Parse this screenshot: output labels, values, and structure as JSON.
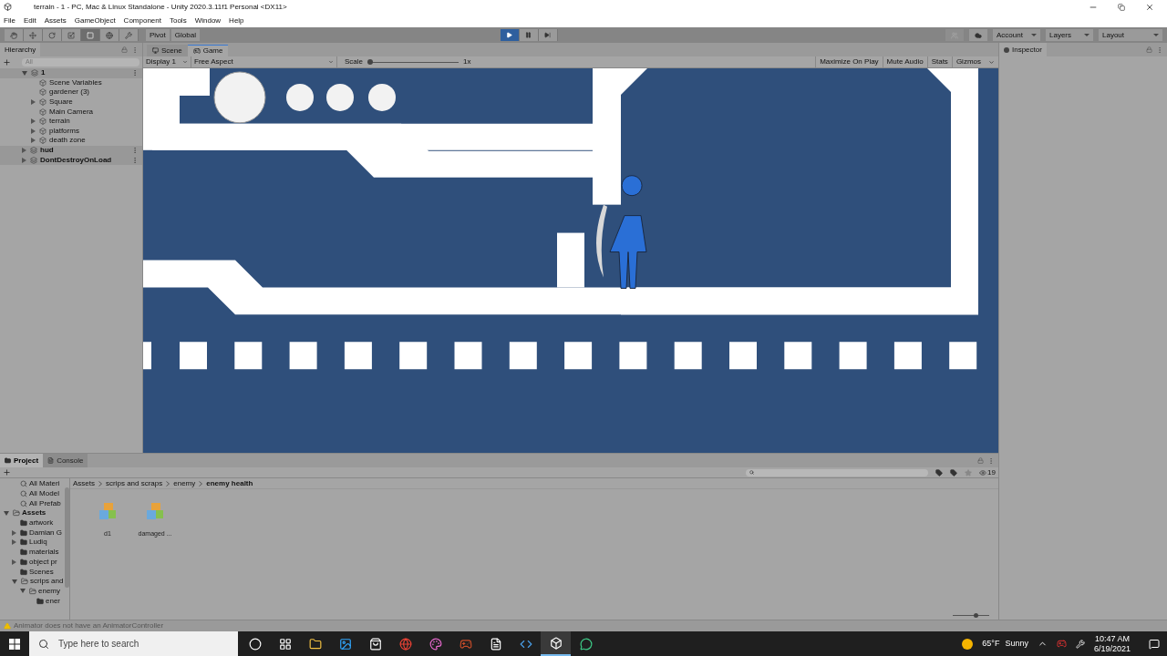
{
  "window": {
    "title": "terrain - 1 - PC, Mac & Linux Standalone - Unity 2020.3.11f1 Personal <DX11>"
  },
  "menu": [
    "File",
    "Edit",
    "Assets",
    "GameObject",
    "Component",
    "Tools",
    "Window",
    "Help"
  ],
  "toolbar": {
    "tools": [
      {
        "kind": "hand",
        "selected": false
      },
      {
        "kind": "move",
        "selected": false
      },
      {
        "kind": "rotate",
        "selected": false
      },
      {
        "kind": "scale",
        "selected": false
      },
      {
        "kind": "rect",
        "selected": true
      },
      {
        "kind": "transform",
        "selected": false
      },
      {
        "kind": "custom",
        "selected": false
      }
    ],
    "pivot": "Pivot",
    "global": "Global",
    "playback": [
      {
        "kind": "play",
        "selected": true
      },
      {
        "kind": "pause",
        "selected": false
      },
      {
        "kind": "step",
        "selected": false
      }
    ],
    "dropdowns": [
      "Account",
      "Layers",
      "Layout"
    ]
  },
  "hierarchy": {
    "title": "Hierarchy",
    "search_placeholder": "All",
    "items": [
      {
        "label": "1",
        "kind": "scene",
        "expanded": true,
        "children": [
          {
            "label": "Scene Variables",
            "kind": "object"
          },
          {
            "label": "gardener (3)",
            "kind": "object"
          },
          {
            "label": "Square",
            "kind": "object",
            "expanded": false
          },
          {
            "label": "Main Camera",
            "kind": "object"
          },
          {
            "label": "terrain",
            "kind": "object",
            "expanded": false
          },
          {
            "label": "platforms",
            "kind": "object",
            "expanded": false
          },
          {
            "label": "death zone",
            "kind": "object",
            "expanded": false
          }
        ]
      },
      {
        "label": "hud",
        "kind": "scene",
        "expanded": false
      },
      {
        "label": "DontDestroyOnLoad",
        "kind": "scene",
        "expanded": false
      }
    ]
  },
  "game_view": {
    "tabs": [
      {
        "label": "Scene",
        "kind": "scene",
        "selected": false
      },
      {
        "label": "Game",
        "kind": "game",
        "selected": true
      }
    ],
    "display": "Display 1",
    "aspect": "Free Aspect",
    "scale_label": "Scale",
    "scale": {
      "level": 0.0
    },
    "scale_value": "1x",
    "buttons": [
      {
        "label": "Maximize On Play",
        "on": false
      },
      {
        "label": "Mute Audio",
        "on": false
      },
      {
        "label": "Stats",
        "on": false
      },
      {
        "label": "Gizmos",
        "on": false
      }
    ]
  },
  "inspector": {
    "title": "Inspector"
  },
  "project": {
    "tabs": [
      {
        "label": "Project",
        "kind": "project",
        "selected": true
      },
      {
        "label": "Console",
        "kind": "console",
        "selected": false
      }
    ],
    "tree": [
      {
        "label": "All Materi",
        "kind": "search"
      },
      {
        "label": "All Model",
        "kind": "search"
      },
      {
        "label": "All Prefab",
        "kind": "search"
      },
      {
        "label": "Assets",
        "kind": "root",
        "expanded": true,
        "children": [
          {
            "label": "artwork",
            "kind": "folder"
          },
          {
            "label": "Damian G",
            "kind": "folder",
            "expanded": false
          },
          {
            "label": "Ludiq",
            "kind": "folder",
            "expanded": false
          },
          {
            "label": "materials",
            "kind": "folder"
          },
          {
            "label": "object pr",
            "kind": "folder",
            "expanded": false
          },
          {
            "label": "Scenes",
            "kind": "folder"
          },
          {
            "label": "scrips and",
            "kind": "folder",
            "expanded": true,
            "children": [
              {
                "label": "enemy",
                "kind": "folder",
                "expanded": true,
                "children": [
                  {
                    "label": "ener",
                    "kind": "folder"
                  }
                ]
              }
            ]
          }
        ]
      }
    ],
    "breadcrumb": [
      "Assets",
      "scrips and scraps",
      "enemy",
      "enemy health"
    ],
    "assets": [
      {
        "label": "d1"
      },
      {
        "label": "damaged ..."
      }
    ],
    "hidden_count": "19",
    "icon_size": {
      "level": 0.65
    }
  },
  "status": {
    "message": "Animator does not have an AnimatorController"
  },
  "taskbar": {
    "search_placeholder": "Type here to search",
    "apps": [
      {
        "kind": "cortana",
        "selected": false
      },
      {
        "kind": "taskview",
        "selected": false
      },
      {
        "kind": "folder",
        "selected": false
      },
      {
        "kind": "ps",
        "selected": false
      },
      {
        "kind": "store",
        "selected": false
      },
      {
        "kind": "chrome",
        "selected": false
      },
      {
        "kind": "paint",
        "selected": false
      },
      {
        "kind": "game",
        "selected": false
      },
      {
        "kind": "file",
        "selected": false
      },
      {
        "kind": "vscode",
        "selected": false
      },
      {
        "kind": "unity",
        "selected": true
      },
      {
        "kind": "chat",
        "selected": false
      }
    ],
    "temperature": "65°F",
    "weather": "Sunny",
    "time": "10:47 AM",
    "date": "6/19/2021"
  }
}
